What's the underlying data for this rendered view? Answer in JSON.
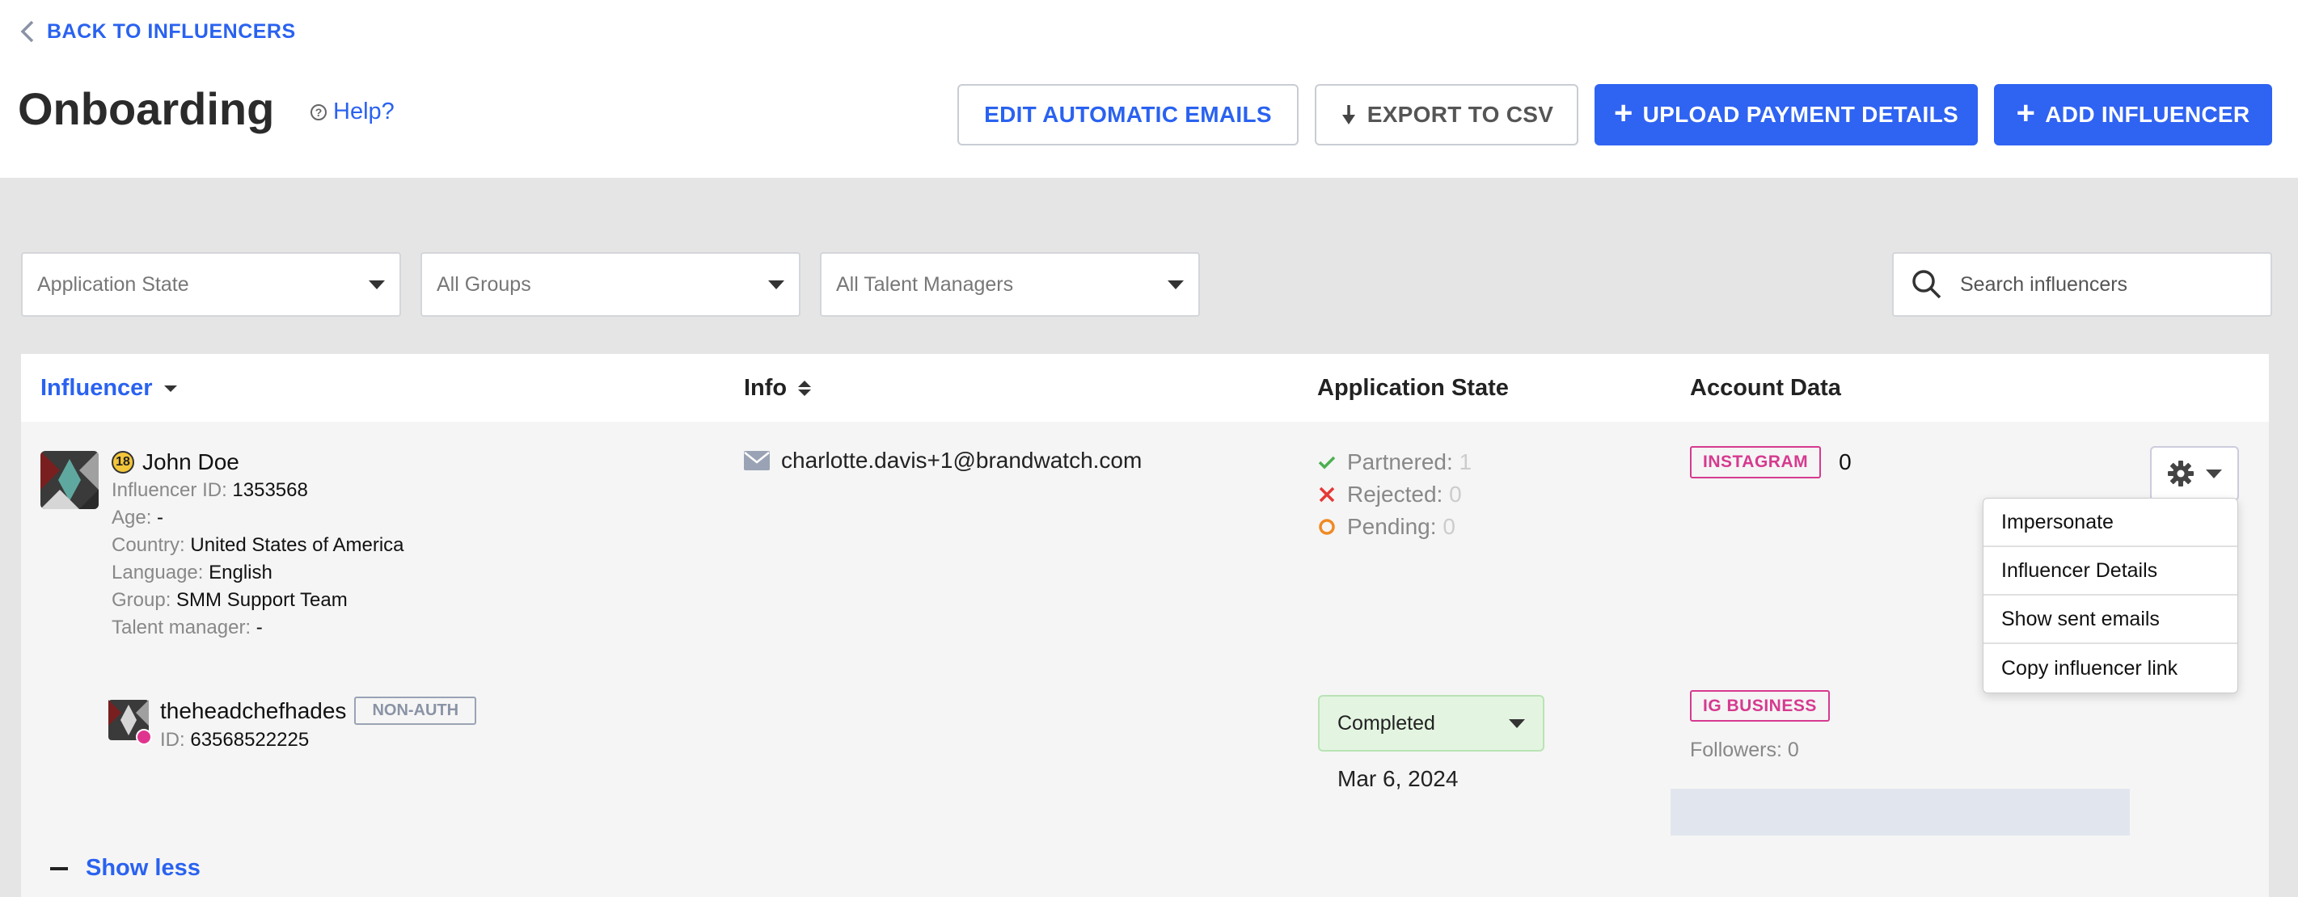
{
  "header": {
    "back_label": "BACK TO INFLUENCERS",
    "title": "Onboarding",
    "help_label": "Help?",
    "buttons": {
      "edit_emails": "EDIT AUTOMATIC EMAILS",
      "export_csv": "EXPORT TO CSV",
      "upload_payment": "UPLOAD PAYMENT DETAILS",
      "add_influencer": "ADD INFLUENCER"
    }
  },
  "filters": {
    "application_state": "Application State",
    "groups": "All Groups",
    "talent_managers": "All Talent Managers",
    "search_placeholder": "Search influencers"
  },
  "table": {
    "columns": {
      "influencer": "Influencer",
      "info": "Info",
      "application_state": "Application State",
      "account_data": "Account Data"
    },
    "row": {
      "age_badge": "18",
      "name": "John Doe",
      "details": [
        {
          "label": "Influencer ID:",
          "value": "1353568"
        },
        {
          "label": "Age:",
          "value": "-"
        },
        {
          "label": "Country:",
          "value": "United States of America"
        },
        {
          "label": "Language:",
          "value": "English"
        },
        {
          "label": "Group:",
          "value": "SMM Support Team"
        },
        {
          "label": "Talent manager:",
          "value": "-"
        }
      ],
      "email": "charlotte.davis+1@brandwatch.com",
      "states": [
        {
          "label": "Partnered:",
          "value": "1"
        },
        {
          "label": "Rejected:",
          "value": "0"
        },
        {
          "label": "Pending:",
          "value": "0"
        }
      ],
      "account_tag": "INSTAGRAM",
      "account_value": "0",
      "menu": [
        "Impersonate",
        "Influencer Details",
        "Show sent emails",
        "Copy influencer link"
      ],
      "sub_account": {
        "handle": "theheadchefhades",
        "auth_tag": "NON-AUTH",
        "id_label": "ID:",
        "id_value": "63568522225",
        "status": "Completed",
        "date": "Mar 6, 2024",
        "tag": "IG BUSINESS",
        "followers": "Followers: 0"
      }
    },
    "show_less": "Show less"
  },
  "colors": {
    "accent": "#2a62f0",
    "primary_button": "#2f63f2",
    "tag_pink": "#d63a8f",
    "partnered": "#4caf50",
    "rejected": "#e53935",
    "pending": "#f08a24"
  }
}
